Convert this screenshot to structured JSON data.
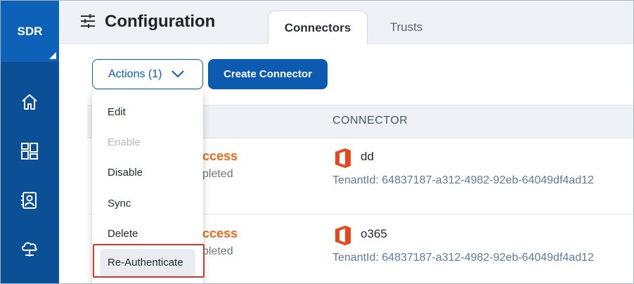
{
  "nav": {
    "brand": "SDR",
    "icons": [
      "home-icon",
      "dashboard-icon",
      "contacts-icon",
      "cloud-network-icon"
    ]
  },
  "header": {
    "title": "Configuration",
    "tabs": [
      {
        "label": "Connectors",
        "active": true
      },
      {
        "label": "Trusts",
        "active": false
      }
    ]
  },
  "toolbar": {
    "actions_label": "Actions (1)",
    "create_label": "Create Connector"
  },
  "actions_menu": {
    "items": [
      {
        "label": "Edit",
        "enabled": true
      },
      {
        "label": "Enable",
        "enabled": false
      },
      {
        "label": "Disable",
        "enabled": true
      },
      {
        "label": "Sync",
        "enabled": true
      },
      {
        "label": "Delete",
        "enabled": true
      },
      {
        "label": "Re-Authenticate",
        "enabled": true,
        "highlighted": true
      }
    ]
  },
  "table": {
    "columns": {
      "connector": "CONNECTOR"
    },
    "rows": [
      {
        "status": "ccess",
        "status_detail": "pleted",
        "connector_name": "dd",
        "tenant": "TenantId: 64837187-a312-4982-92eb-64049df4ad12"
      },
      {
        "status": "ccess",
        "status_detail": "pleted",
        "connector_name": "o365",
        "tenant": "TenantId: 64837187-a312-4982-92eb-64049df4ad12"
      }
    ]
  },
  "colors": {
    "nav_bg": "#0b4f96",
    "brand_bg": "#0d62b8",
    "primary": "#0d5bb0",
    "status_success": "#ea6a1c",
    "office_red": "#e8471b",
    "highlight_red": "#d9362f"
  }
}
